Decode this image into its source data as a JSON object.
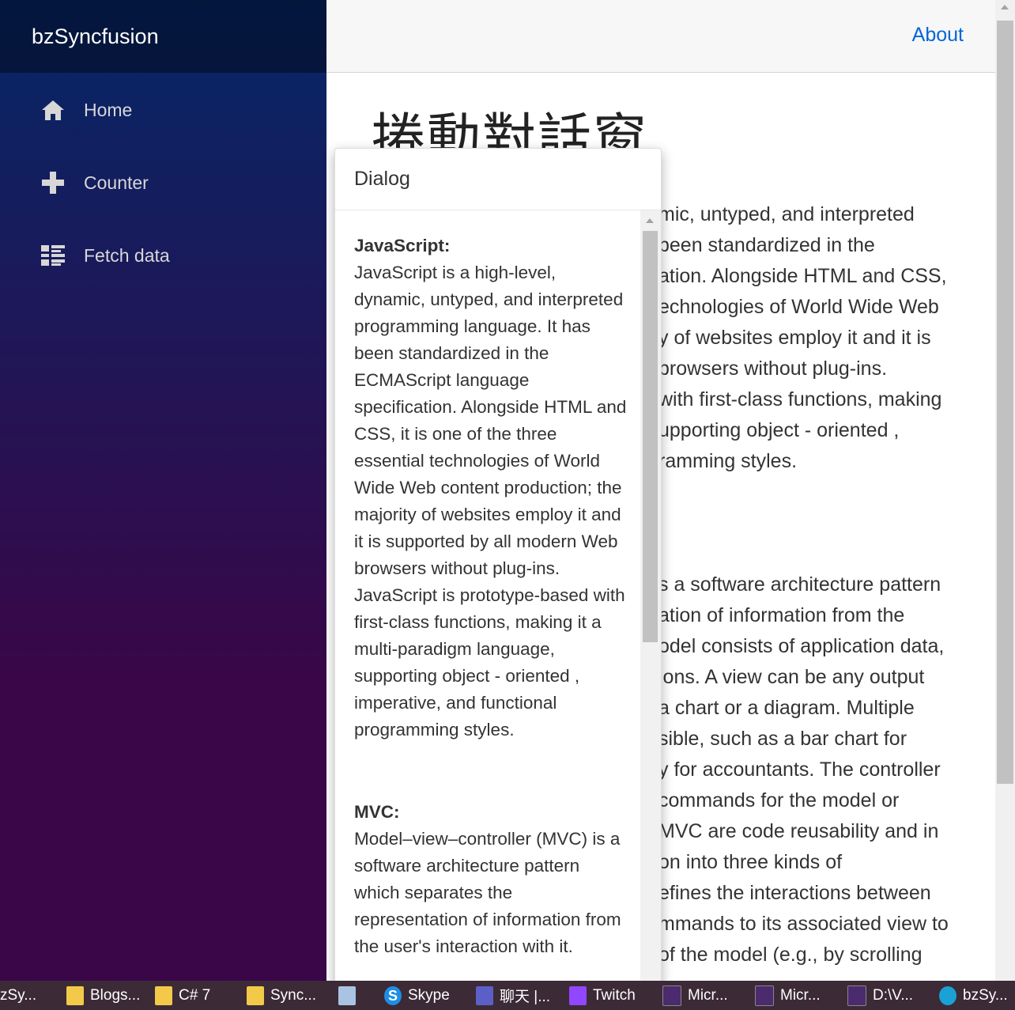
{
  "sidebar": {
    "brand": "bzSyncfusion",
    "items": [
      {
        "label": "Home",
        "icon": "home-icon"
      },
      {
        "label": "Counter",
        "icon": "plus-icon"
      },
      {
        "label": "Fetch data",
        "icon": "list-icon"
      }
    ]
  },
  "header": {
    "about": "About"
  },
  "main": {
    "title": "捲動對話窗",
    "bg_lines_1": [
      "mic, untyped, and interpreted",
      "been standardized in the",
      "ation. Alongside HTML and CSS,",
      "echnologies of World Wide Web",
      "y of websites employ it and it is",
      "browsers without plug-ins.",
      "with first-class functions, making",
      "upporting object - oriented ,",
      "ramming styles."
    ],
    "bg_lines_2": [
      "s a software architecture pattern",
      "ation of information from the",
      "odel consists of application data,",
      "ions. A view can be any output",
      "a chart or a diagram. Multiple",
      "sible, such as a bar chart for",
      "y for accountants. The controller",
      "commands for the model or",
      "MVC are code reusability and in",
      "on into three kinds of",
      "efines the interactions between",
      "mmands to its associated view to",
      "of the model (e.g., by scrolling"
    ]
  },
  "dialog": {
    "title": "Dialog",
    "sections": [
      {
        "term": "JavaScript:",
        "text": "JavaScript is a high-level, dynamic, untyped, and interpreted programming language. It has been standardized in the ECMAScript language specification. Alongside HTML and CSS, it is one of the three essential technologies of World Wide Web content production; the majority of websites employ it and it is supported by all modern Web browsers without plug-ins. JavaScript is prototype-based with first-class functions, making it a multi-paradigm language, supporting object - oriented , imperative, and functional programming styles."
      },
      {
        "term": "MVC:",
        "text": "Model–view–controller (MVC) is a software architecture pattern which separates the representation of information from the user's interaction with it."
      }
    ]
  },
  "taskbar": {
    "items": [
      {
        "label": "zSy...",
        "icon": "app-icon"
      },
      {
        "label": "Blogs...",
        "icon": "folder-icon"
      },
      {
        "label": "C# 7",
        "icon": "folder-icon"
      },
      {
        "label": "Sync...",
        "icon": "folder-icon"
      },
      {
        "label": "",
        "icon": "app-icon"
      },
      {
        "label": "Skype",
        "icon": "skype-icon"
      },
      {
        "label": "聊天 |...",
        "icon": "teams-icon"
      },
      {
        "label": "Twitch",
        "icon": "twitch-icon"
      },
      {
        "label": "Micr...",
        "icon": "terminal-icon"
      },
      {
        "label": "Micr...",
        "icon": "terminal-icon"
      },
      {
        "label": "D:\\V...",
        "icon": "terminal-icon"
      },
      {
        "label": "bzSy...",
        "icon": "edge-icon"
      }
    ]
  }
}
